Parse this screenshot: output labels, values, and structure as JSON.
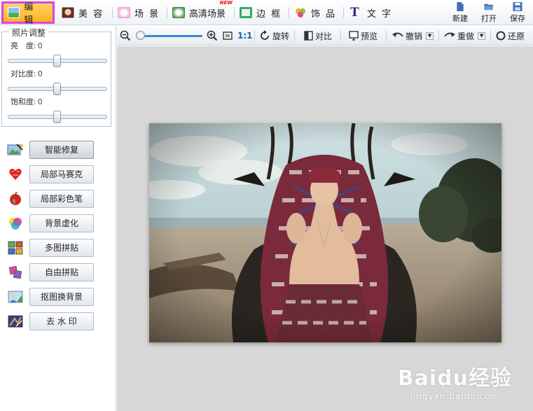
{
  "menu": {
    "edit": "编 辑",
    "beauty": "美 容",
    "scene": "场 景",
    "hd_scene": "高清场景",
    "new_badge": "NEW",
    "border": "边 框",
    "decor": "饰 品",
    "text": "文 字",
    "new": "新建",
    "open": "打开",
    "save": "保存"
  },
  "adjust": {
    "title": "照片调整",
    "brightness_label": "亮　度:",
    "brightness_value": "0",
    "contrast_label": "对比度:",
    "contrast_value": "0",
    "saturation_label": "饱和度:",
    "saturation_value": "0"
  },
  "tools": [
    {
      "label": "智能修复"
    },
    {
      "label": "局部马赛克"
    },
    {
      "label": "局部彩色笔"
    },
    {
      "label": "背景虚化"
    },
    {
      "label": "多图拼贴"
    },
    {
      "label": "自由拼贴"
    },
    {
      "label": "抠图换背景"
    },
    {
      "label": "去 水 印"
    }
  ],
  "toolbar": {
    "ratio": "1:1",
    "rotate": "旋转",
    "compare": "对比",
    "preview": "预览",
    "undo": "撤销",
    "redo": "重做",
    "restore": "还原"
  },
  "watermark": {
    "main": "Baidu经验",
    "sub": "jingyan.baidu.com"
  },
  "colors": {
    "active_border": "#e040e0",
    "active_bg": "#ffb21a",
    "zoom_track": "#3a88d8"
  }
}
